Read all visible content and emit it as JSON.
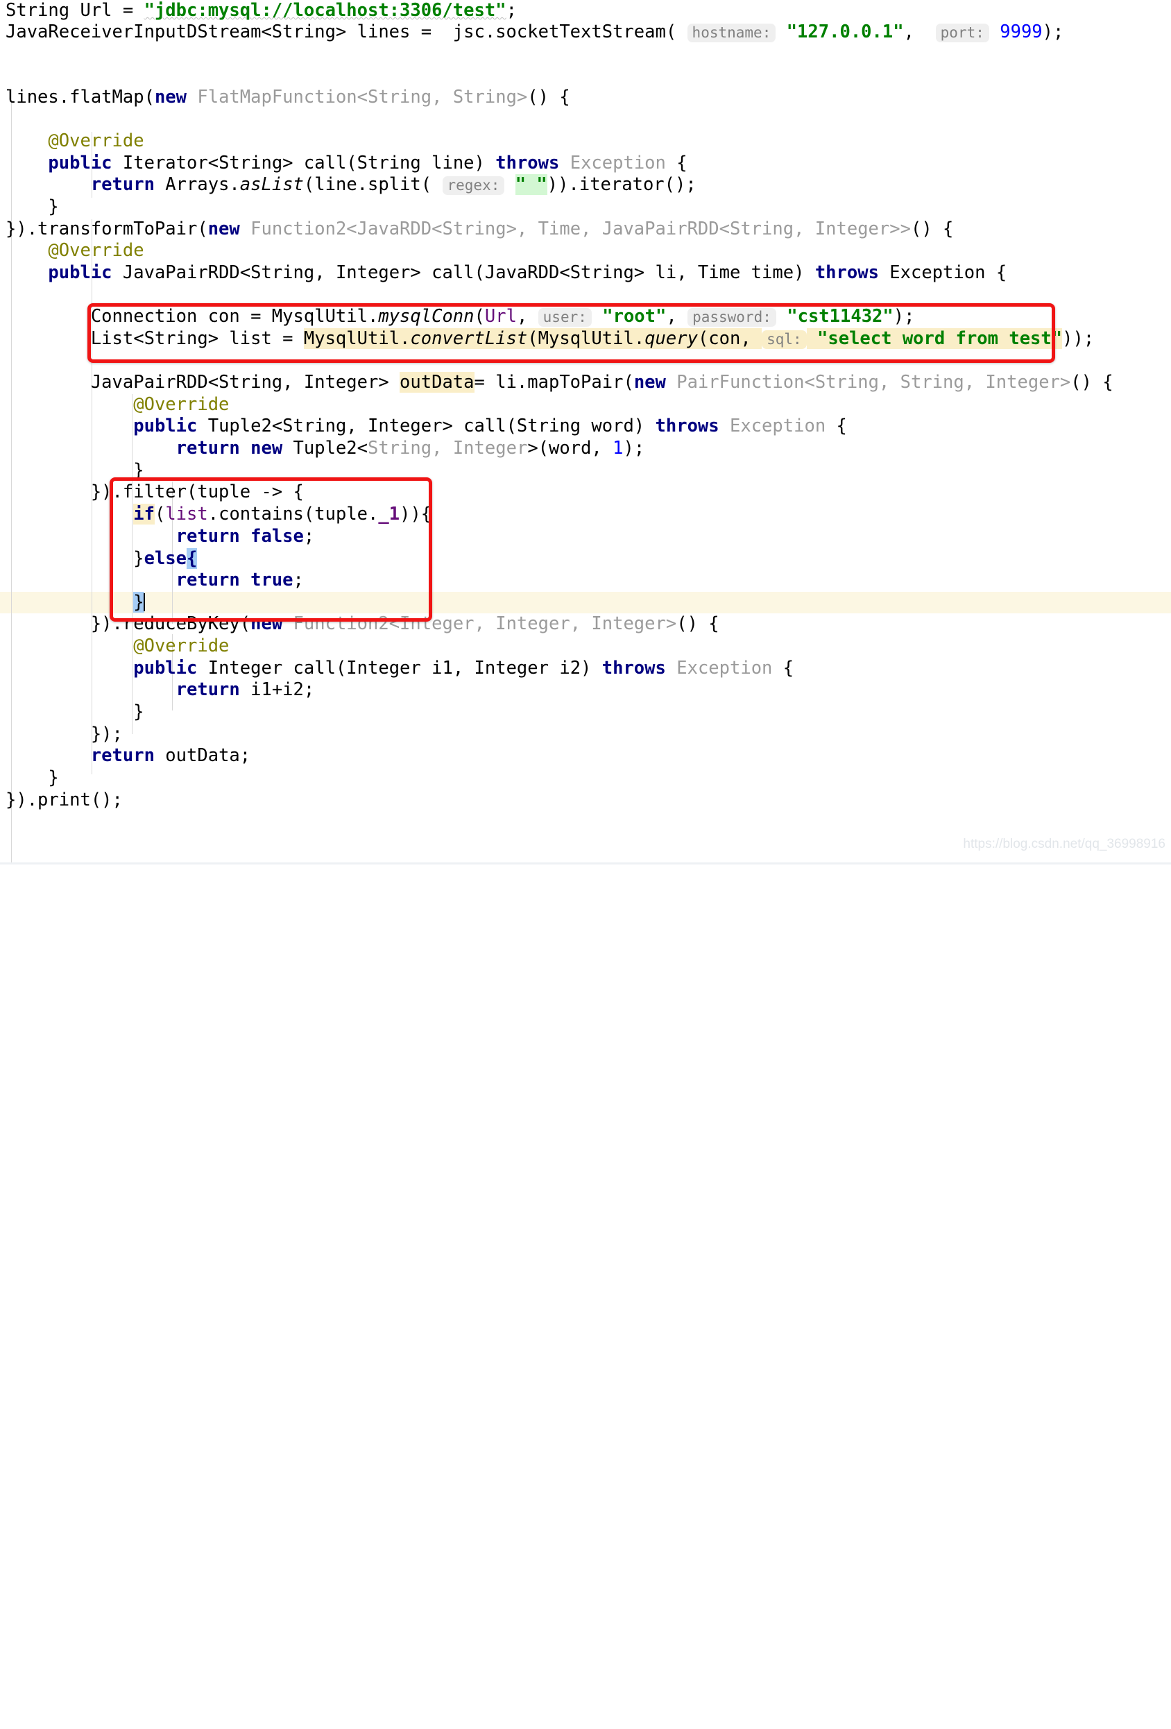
{
  "editor": {
    "language": "Java",
    "theme": "IntelliJ Light",
    "font_size_px": 25,
    "colors": {
      "keyword": "#000080",
      "string": "#008000",
      "number": "#0000ff",
      "faded_type": "#9b9b9b",
      "field": "#660e7a",
      "annotation": "#808000",
      "inlay_hint_bg": "#efefef",
      "inlay_hint_text": "#808080",
      "usage_highlight": "#faeec8",
      "brace_match_highlight": "#a5ccf5",
      "current_line": "#fcf7e3",
      "annotation_box": "#f01414",
      "background": "#ffffff"
    },
    "caret_line_text": "}",
    "watermark": "https://blog.csdn.net/qq_36998916"
  },
  "annotations": {
    "box_1_label": "mysql-connection-and-query-box",
    "box_2_label": "filter-lambda-box"
  },
  "code": {
    "lines": [
      "String Url = \"jdbc:mysql://localhost:3306/test\";",
      "JavaReceiverInputDStream<String> lines =  jsc.socketTextStream( hostname: \"127.0.0.1\",  port: 9999);",
      "",
      "",
      "lines.flatMap(new FlatMapFunction<String, String>() {",
      "",
      "    @Override",
      "    public Iterator<String> call(String line) throws Exception {",
      "        return Arrays.asList(line.split( regex: \" \")).iterator();",
      "    }",
      "}).transformToPair(new Function2<JavaRDD<String>, Time, JavaPairRDD<String, Integer>>() {",
      "    @Override",
      "    public JavaPairRDD<String, Integer> call(JavaRDD<String> li, Time time) throws Exception {",
      "",
      "        Connection con = MysqlUtil.mysqlConn(Url, user: \"root\", password: \"cst11432\");",
      "        List<String> list = MysqlUtil.convertList(MysqlUtil.query(con, sql: \"select word from test\"));",
      "",
      "        JavaPairRDD<String, Integer> outData= li.mapToPair(new PairFunction<String, String, Integer>() {",
      "            @Override",
      "            public Tuple2<String, Integer> call(String word) throws Exception {",
      "                return new Tuple2<String, Integer>(word, 1);",
      "            }",
      "        }).filter(tuple -> {",
      "            if(list.contains(tuple._1)){",
      "                return false;",
      "            }else{",
      "                return true;",
      "            }",
      "        }).reduceByKey(new Function2<Integer, Integer, Integer>() {",
      "            @Override",
      "            public Integer call(Integer i1, Integer i2) throws Exception {",
      "                return i1+i2;",
      "            }",
      "        });",
      "        return outData;",
      "    }",
      "}).print();"
    ],
    "inlay_hints": [
      "hostname:",
      "port:",
      "regex:",
      "user:",
      "password:",
      "sql:"
    ],
    "string_literals": [
      "\"jdbc:mysql://localhost:3306/test\"",
      "\"127.0.0.1\"",
      "\" \"",
      "\"root\"",
      "\"cst11432\"",
      "\"select word from test\""
    ],
    "numbers": [
      "9999",
      "1"
    ],
    "highlighted_identifiers": [
      "outData",
      "if",
      "list",
      "_1"
    ]
  }
}
